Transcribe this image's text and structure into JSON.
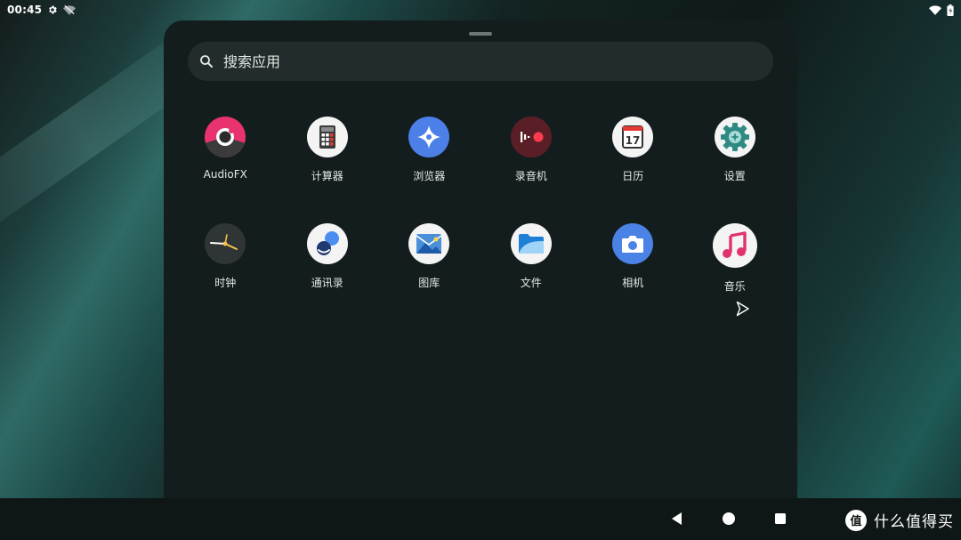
{
  "status_bar": {
    "time": "00:45",
    "icons": [
      "settings-icon",
      "no-signal-icon",
      "wifi-icon",
      "battery-icon"
    ]
  },
  "search": {
    "placeholder": "搜索应用"
  },
  "apps": [
    {
      "label": "AudioFX",
      "icon": "audiofx-icon"
    },
    {
      "label": "计算器",
      "icon": "calculator-icon"
    },
    {
      "label": "浏览器",
      "icon": "browser-icon"
    },
    {
      "label": "录音机",
      "icon": "recorder-icon"
    },
    {
      "label": "日历",
      "icon": "calendar-icon",
      "day": "17"
    },
    {
      "label": "设置",
      "icon": "settings-icon"
    },
    {
      "label": "时钟",
      "icon": "clock-icon"
    },
    {
      "label": "通讯录",
      "icon": "contacts-icon"
    },
    {
      "label": "图库",
      "icon": "gallery-icon"
    },
    {
      "label": "文件",
      "icon": "files-icon"
    },
    {
      "label": "相机",
      "icon": "camera-icon"
    },
    {
      "label": "音乐",
      "icon": "music-icon"
    }
  ],
  "nav_bar": {
    "buttons": [
      "back-icon",
      "home-icon",
      "recents-icon"
    ]
  },
  "watermark": {
    "logo": "值",
    "text": "什么值得买"
  },
  "colors": {
    "drawer_bg": "#141d1d",
    "search_bg": "#232c2c",
    "accent_teal": "#2f6a66"
  }
}
